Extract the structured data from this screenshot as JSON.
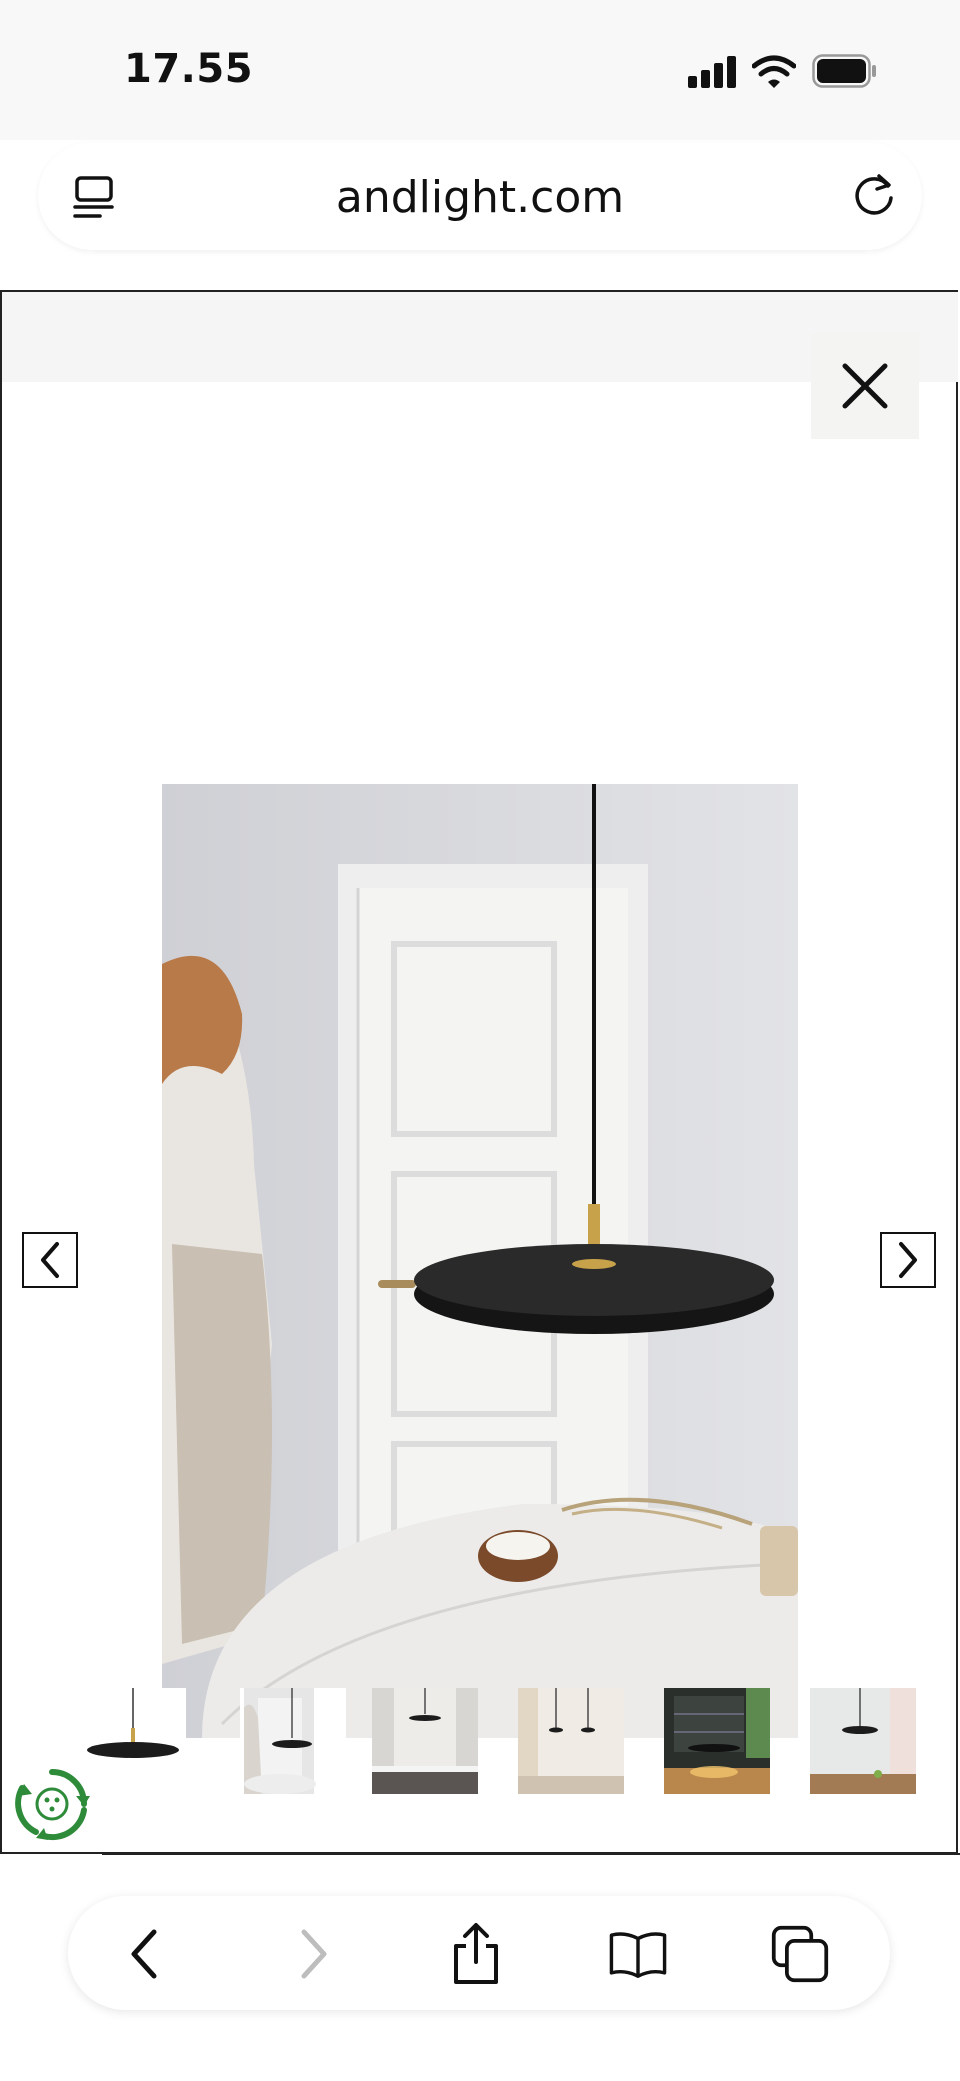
{
  "status_bar": {
    "time": "17.55"
  },
  "address_bar": {
    "url": "andlight.com"
  },
  "toolbar": {
    "back_icon": "chevron-left-icon",
    "forward_icon": "chevron-right-icon",
    "share_icon": "share-icon",
    "bookmarks_icon": "book-icon",
    "tabs_icon": "tabs-icon"
  },
  "gallery": {
    "main_image": "pendant-lamp-room-photo",
    "thumbnail_count": 6,
    "selected_thumbnail": 1
  },
  "colors": {
    "lamp_black": "#1c1c1c",
    "brass": "#c8a24a",
    "wall": "#d8d9dd",
    "eco_green": "#2e8b3a"
  }
}
